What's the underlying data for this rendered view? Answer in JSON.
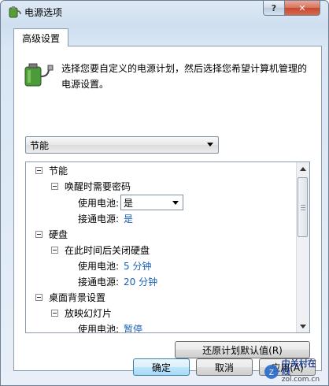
{
  "window": {
    "title": "电源选项",
    "help": "?",
    "close": "✕"
  },
  "tab": {
    "label": "高级设置"
  },
  "description": "选择您要自定义的电源计划，然后选择您希望计算机管理的电源设置。",
  "plan_select": {
    "value": "节能"
  },
  "tree": {
    "plan": "节能",
    "wake_password": "唤醒时需要密码",
    "on_battery_label": "使用电池:",
    "on_battery_value": "是",
    "plugged_in_label": "接通电源:",
    "plugged_in_value": "是",
    "hard_disk": "硬盘",
    "turn_off_disk": "在此时间后关闭硬盘",
    "disk_battery_label": "使用电池:",
    "disk_battery_value": "5 分钟",
    "disk_plugged_label": "接通电源:",
    "disk_plugged_value": "20 分钟",
    "desktop_bg": "桌面背景设置",
    "slideshow": "放映幻灯片",
    "slideshow_battery_label": "使用电池:",
    "slideshow_battery_value": "暂停"
  },
  "buttons": {
    "restore": "还原计划默认值(R)",
    "ok": "确定",
    "cancel": "取消",
    "apply": "应用(A)"
  },
  "watermark": {
    "line1": "中关村在线",
    "line2": "zol.com.cn"
  },
  "colors": {
    "link": "#1a5fb4",
    "close": "#c44a2f"
  }
}
